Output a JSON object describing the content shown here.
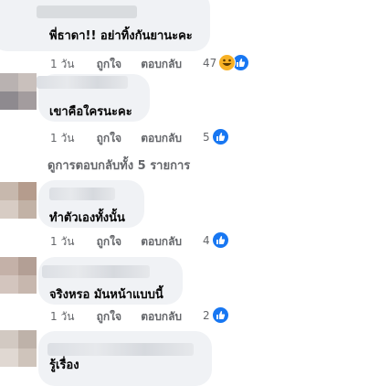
{
  "comments": [
    {
      "text": "พี่ธาดา!! อย่าทิ้งกันยานะคะ",
      "time": "1 วัน",
      "like": "ถูกใจ",
      "reply": "ตอบกลับ",
      "reactions": "47"
    },
    {
      "text": "เขาคือใครนะคะ",
      "time": "1 วัน",
      "like": "ถูกใจ",
      "reply": "ตอบกลับ",
      "reactions": "5"
    },
    {
      "text": "ทำตัวเองทั้งนั้น",
      "time": "1 วัน",
      "like": "ถูกใจ",
      "reply": "ตอบกลับ",
      "reactions": "4"
    },
    {
      "text": "จริงหรอ มันหน้าแบบนี้",
      "time": "1 วัน",
      "like": "ถูกใจ",
      "reply": "ตอบกลับ",
      "reactions": "2"
    },
    {
      "text": "รู้เรื่อง"
    }
  ],
  "view_replies": "ดูการตอบกลับทั้ง 5 รายการ",
  "colors": {
    "like": "#1877f2",
    "haha": "#f7b125",
    "bubble": "#f0f2f5",
    "meta": "#65676b"
  }
}
